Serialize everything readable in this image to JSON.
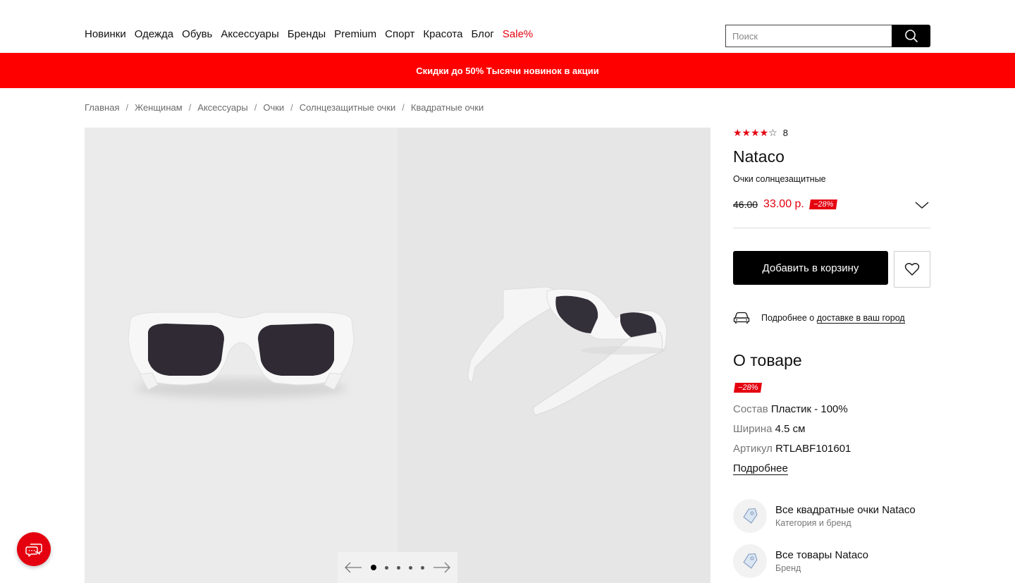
{
  "nav": {
    "items": [
      "Новинки",
      "Одежда",
      "Обувь",
      "Аксессуары",
      "Бренды",
      "Premium",
      "Спорт",
      "Красота",
      "Блог"
    ],
    "sale": "Sale%"
  },
  "search": {
    "placeholder": "Поиск",
    "icon": "search-icon"
  },
  "promo": {
    "text": "Скидки до 50% Тысячи новинок в акции",
    "color": "#ff0000"
  },
  "breadcrumb": [
    "Главная",
    "Женщинам",
    "Аксессуары",
    "Очки",
    "Солнцезащитные очки",
    "Квадратные очки"
  ],
  "gallery": {
    "pages": 5,
    "active_page": 1
  },
  "product": {
    "rating": 4,
    "rating_max": 5,
    "reviews_count": "8",
    "brand": "Nataco",
    "subtitle": "Очки солнцезащитные",
    "old_price": "46.00",
    "new_price": "33.00 р.",
    "discount": "−28%",
    "cart_button": "Добавить в корзину",
    "delivery_prefix": "Подробнее о ",
    "delivery_link": "доставке в ваш город"
  },
  "about": {
    "title": "О товаре",
    "discount": "−28%",
    "attributes": [
      {
        "key": "Состав",
        "value": "Пластик - 100%"
      },
      {
        "key": "Ширина",
        "value": "4.5 см"
      },
      {
        "key": "Артикул",
        "value": "RTLABF101601"
      }
    ],
    "more_link": "Подробнее"
  },
  "related": [
    {
      "title": "Все квадратные очки Nataco",
      "subtitle": "Категория и бренд"
    },
    {
      "title": "Все товары Nataco",
      "subtitle": "Бренд"
    }
  ],
  "colors": {
    "accent": "#e4000f",
    "button": "#000000"
  }
}
